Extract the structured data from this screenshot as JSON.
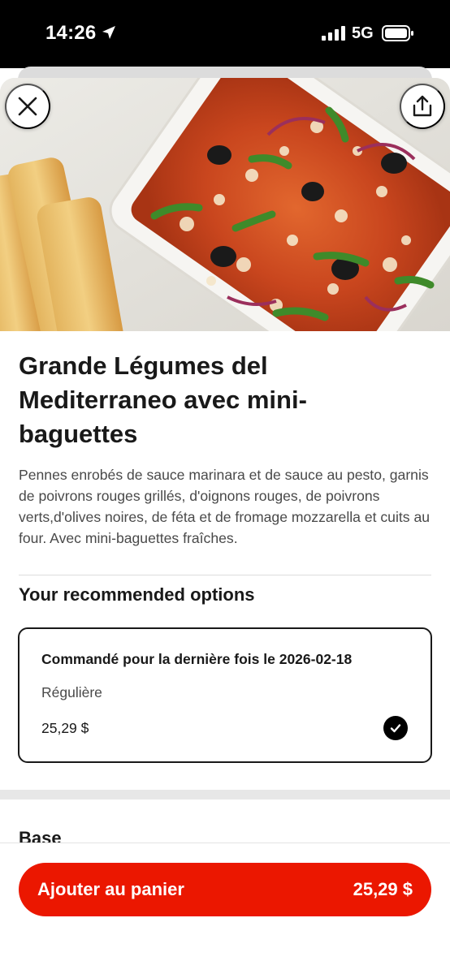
{
  "status_bar": {
    "time": "14:26",
    "network": "5G",
    "icons": [
      "location-arrow-icon",
      "signal-bars-icon",
      "battery-icon"
    ]
  },
  "header": {
    "close_icon": "close-icon",
    "share_icon": "share-icon"
  },
  "item": {
    "title": "Grande Légumes del Mediterraneo avec mini-baguettes",
    "description": "Pennes enrobés de sauce marinara et de sauce au pesto, garnis de poivrons rouges grillés, d'oignons rouges, de poivrons verts,d'olives noires, de féta et de fromage mozzarella et cuits au four. Avec mini-baguettes fraîches."
  },
  "recommended": {
    "heading": "Your recommended options",
    "option": {
      "last_ordered": "Commandé pour la dernière fois le 2026-02-18",
      "size": "Régulière",
      "price": "25,29 $",
      "selected": true
    }
  },
  "next_section": {
    "heading": "Base"
  },
  "cta": {
    "label": "Ajouter au panier",
    "price": "25,29 $"
  },
  "colors": {
    "accent": "#eb1700",
    "text": "#191919",
    "secondary_text": "#494949"
  }
}
